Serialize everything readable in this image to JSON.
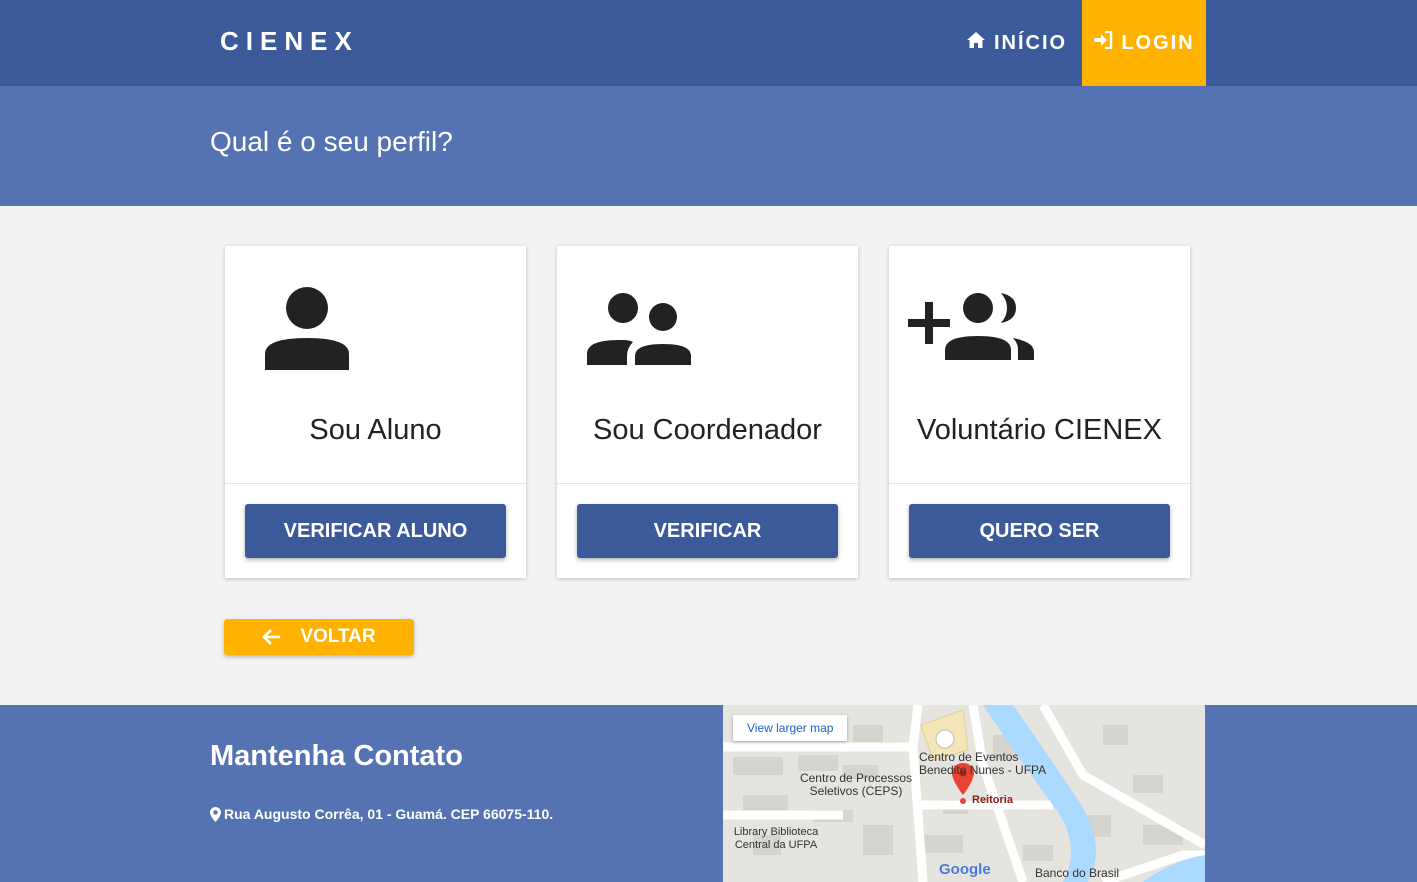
{
  "header": {
    "brand": "CIENEX",
    "nav_inicio": "INÍCIO",
    "nav_login": "LOGIN"
  },
  "banner": {
    "title": "Qual é o seu perfil?"
  },
  "cards": [
    {
      "title": "Sou Aluno",
      "button": "VERIFICAR ALUNO",
      "icon": "person-icon"
    },
    {
      "title": "Sou Coordenador",
      "button": "VERIFICAR",
      "icon": "group-icon"
    },
    {
      "title": "Voluntário CIENEX",
      "button": "QUERO SER",
      "icon": "group-add-icon"
    }
  ],
  "back_button": "VOLTAR",
  "footer": {
    "title": "Mantenha Contato",
    "address": "Rua Augusto Corrêa, 01 - Guamá. CEP 66075-110."
  },
  "map": {
    "link": "View larger map",
    "labels": {
      "eventos": "Centro de Eventos Benedito Nunes - UFPA",
      "ceps": "Centro de Processos Seletivos (CEPS)",
      "reitoria": "Reitoria",
      "library": "Library Biblioteca Central da UFPA",
      "banco": "Banco do Brasil",
      "google": "Google"
    }
  },
  "colors": {
    "navbar": "#3c5a9a",
    "banner": "#5573b2",
    "accent": "#ffb300",
    "button": "#3c5a9a"
  }
}
